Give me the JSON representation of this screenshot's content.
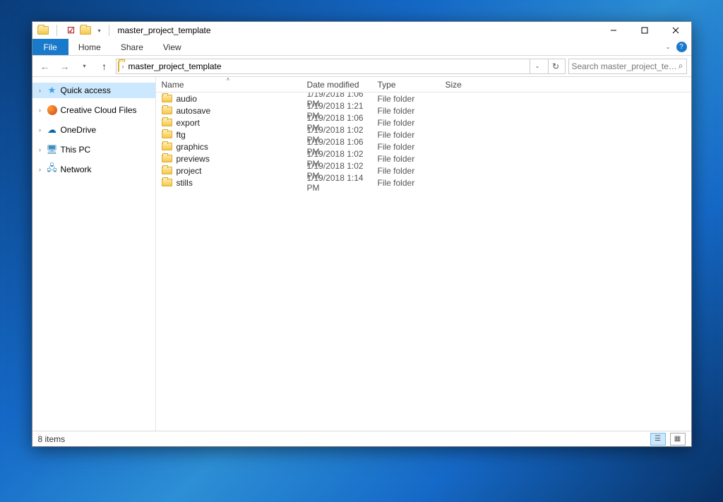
{
  "window": {
    "title": "master_project_template"
  },
  "ribbon": {
    "file": "File",
    "tabs": [
      "Home",
      "Share",
      "View"
    ]
  },
  "address": {
    "crumb": "master_project_template"
  },
  "search": {
    "placeholder": "Search master_project_templa..."
  },
  "navpane": {
    "items": [
      {
        "label": "Quick access",
        "icon": "quickaccess",
        "selected": true
      },
      {
        "label": "Creative Cloud Files",
        "icon": "cc",
        "selected": false
      },
      {
        "label": "OneDrive",
        "icon": "onedrive",
        "selected": false
      },
      {
        "label": "This PC",
        "icon": "thispc",
        "selected": false
      },
      {
        "label": "Network",
        "icon": "network",
        "selected": false
      }
    ]
  },
  "columns": {
    "name": "Name",
    "date": "Date modified",
    "type": "Type",
    "size": "Size"
  },
  "rows": [
    {
      "name": "audio",
      "date": "1/19/2018 1:06 PM",
      "type": "File folder",
      "size": ""
    },
    {
      "name": "autosave",
      "date": "1/19/2018 1:21 PM",
      "type": "File folder",
      "size": ""
    },
    {
      "name": "export",
      "date": "1/19/2018 1:06 PM",
      "type": "File folder",
      "size": ""
    },
    {
      "name": "ftg",
      "date": "1/19/2018 1:02 PM",
      "type": "File folder",
      "size": ""
    },
    {
      "name": "graphics",
      "date": "1/19/2018 1:06 PM",
      "type": "File folder",
      "size": ""
    },
    {
      "name": "previews",
      "date": "1/19/2018 1:02 PM",
      "type": "File folder",
      "size": ""
    },
    {
      "name": "project",
      "date": "1/19/2018 1:02 PM",
      "type": "File folder",
      "size": ""
    },
    {
      "name": "stills",
      "date": "1/19/2018 1:14 PM",
      "type": "File folder",
      "size": ""
    }
  ],
  "status": {
    "count": "8 items"
  }
}
